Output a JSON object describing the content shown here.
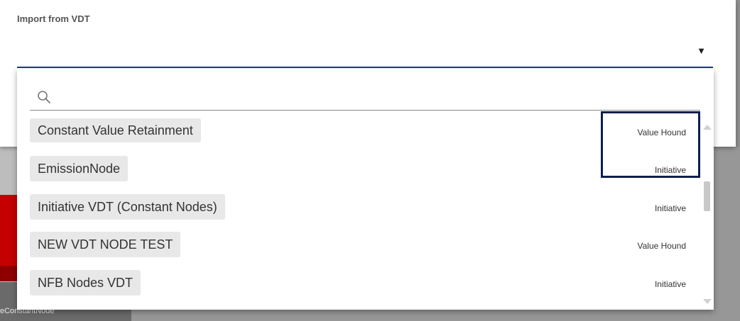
{
  "background": {
    "node_label": "eConstantNode",
    "accent_color": "#c40000"
  },
  "dialog": {
    "field_label": "Import from VDT",
    "select_value": "",
    "select_arrow": "▼",
    "underline_color": "#1f3a93"
  },
  "dropdown": {
    "search": {
      "placeholder": "",
      "value": "",
      "icon": "search-icon"
    },
    "options": [
      {
        "name": "Constant Value Retainment",
        "type": "Value Hound"
      },
      {
        "name": "EmissionNode",
        "type": "Initiative"
      },
      {
        "name": "Initiative VDT (Constant Nodes)",
        "type": "Initiative"
      },
      {
        "name": "NEW VDT NODE TEST",
        "type": "Value Hound"
      },
      {
        "name": "NFB Nodes VDT",
        "type": "Initiative"
      }
    ]
  },
  "annotation": {
    "highlight_color": "#0d1f4f"
  }
}
